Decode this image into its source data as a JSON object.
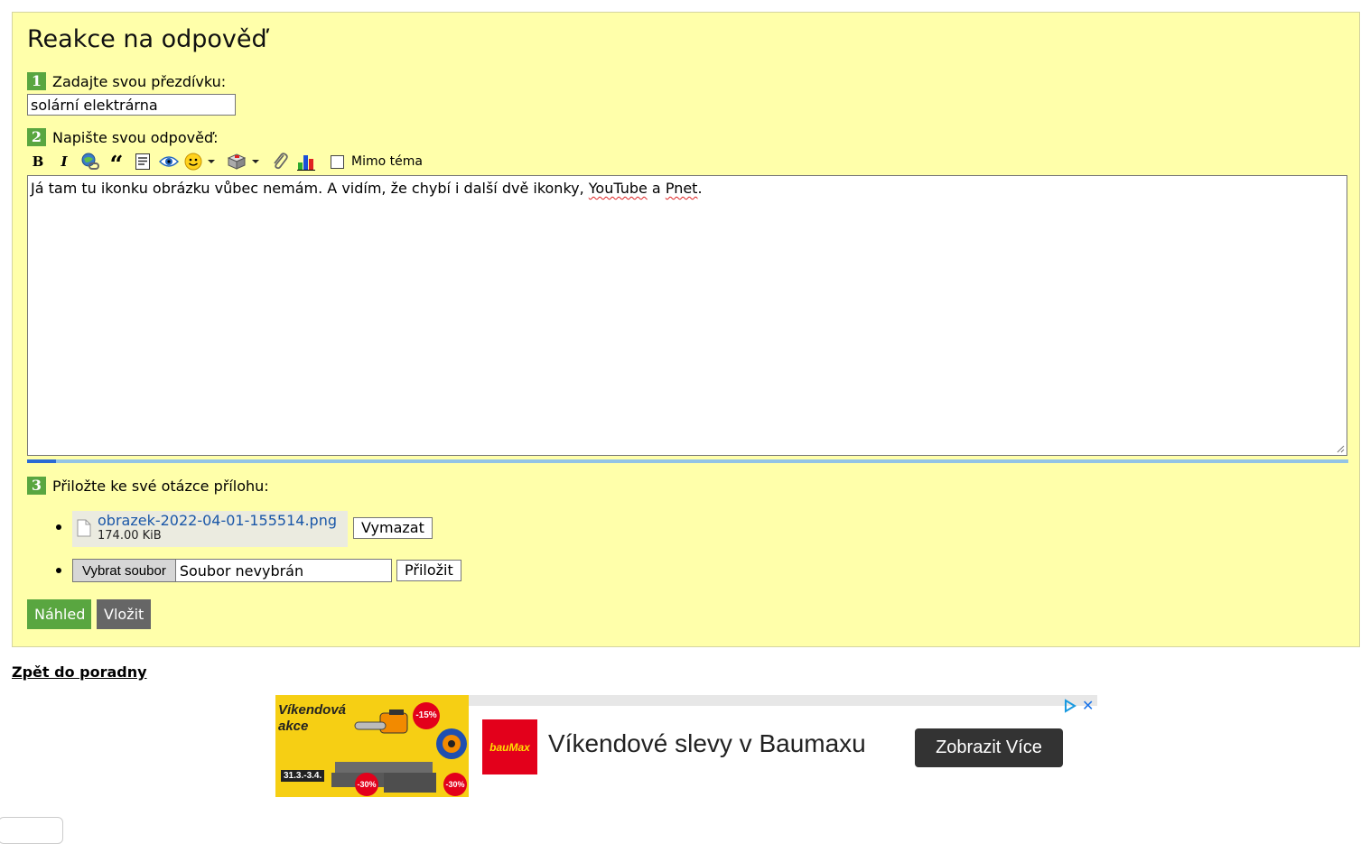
{
  "form": {
    "title": "Reakce na odpověď",
    "step1": {
      "number": "1",
      "label": "Zadajte svou přezdívku:",
      "nickname_value": "solární elektrárna"
    },
    "step2": {
      "number": "2",
      "label": "Napište svou odpověď:"
    },
    "step3": {
      "number": "3",
      "label": "Přiložte ke své otázce přílohu:"
    },
    "toolbar": {
      "buttons": [
        "bold-icon",
        "italic-icon",
        "link-icon",
        "quote-icon",
        "code-icon",
        "spoiler-eye-icon",
        "smiley-icon",
        "embed-box-icon",
        "attachment-clip-icon",
        "poll-chart-icon"
      ],
      "bold_glyph": "B",
      "italic_glyph": "I",
      "quote_glyph": "“",
      "offtopic_label": "Mimo téma",
      "offtopic_checked": false
    },
    "answer": {
      "text_before": "Já tam tu ikonku obrázku vůbec nemám. A vidím, že chybí i další dvě ikonky, ",
      "word_youtube": "YouTube",
      "text_and": " a ",
      "word_pnet": "Pnet",
      "text_end": "."
    },
    "upload_progress": 0.022,
    "attachments": [
      {
        "name": "obrazek-2022-04-01-155514.png",
        "size": "174.00 KiB",
        "remove_label": "Vymazat"
      }
    ],
    "file_picker": {
      "choose_label": "Vybrat soubor",
      "no_file_label": "Soubor nevybrán",
      "attach_label": "Přiložit"
    },
    "preview_label": "Náhled",
    "submit_label": "Vložit"
  },
  "back_link": "Zpět do poradny",
  "ad": {
    "image_title": "Víkendová akce",
    "image_date": "31.3.-3.4.",
    "badge_15": "-15%",
    "badge_30": "-30%",
    "logo_text": "bauMax",
    "headline": "Víkendové slevy v Baumaxu",
    "cta": "Zobrazit Více",
    "close": "✕"
  },
  "colors": {
    "panel_bg": "#ffffaa",
    "step_badge": "#59a640",
    "preview_button": "#59a640",
    "submit_button": "#666666",
    "link": "#1a57a8",
    "ad_red": "#e3001b"
  }
}
